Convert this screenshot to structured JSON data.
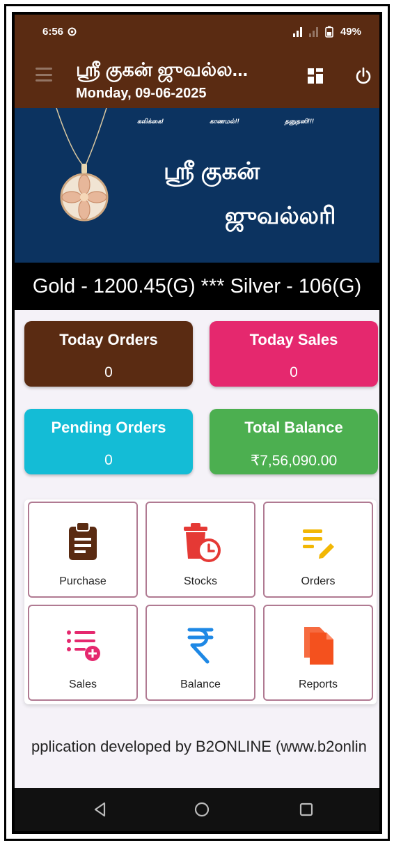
{
  "status": {
    "time": "6:56",
    "battery": "49%"
  },
  "appbar": {
    "title": "ஸ்ரீ குகன் ஜுவல்ல...",
    "date": "Monday, 09-06-2025"
  },
  "banner": {
    "tagline1": "கலிக்கை!",
    "tagline2": "காணமல்!!",
    "tagline3": "தனுதனி!!!",
    "brand_line1": "ஸ்ரீ குகன்",
    "brand_line2": "ஜுவல்லரி"
  },
  "rates": {
    "text": "Gold - 1200.45(G) *** Silver - 106(G)"
  },
  "stats": {
    "today_orders": {
      "label": "Today Orders",
      "value": "0"
    },
    "today_sales": {
      "label": "Today Sales",
      "value": "0"
    },
    "pending_orders": {
      "label": "Pending Orders",
      "value": "0"
    },
    "total_balance": {
      "label": "Total Balance",
      "value": "₹7,56,090.00"
    }
  },
  "menu": {
    "purchase": "Purchase",
    "stocks": "Stocks",
    "orders": "Orders",
    "sales": "Sales",
    "balance": "Balance",
    "reports": "Reports"
  },
  "footer": {
    "text": "pplication developed by B2ONLINE (www.b2onlin"
  },
  "colors": {
    "brand_brown": "#5a2b12",
    "banner_blue": "#0c3360",
    "sales_pink": "#e5286e",
    "pending_cyan": "#14bcd6",
    "balance_green": "#4caf50"
  },
  "icons": {
    "purchase": "clipboard-icon",
    "stocks": "trash-clock-icon",
    "orders": "edit-list-icon",
    "sales": "list-add-icon",
    "balance": "rupee-icon",
    "reports": "documents-icon"
  }
}
